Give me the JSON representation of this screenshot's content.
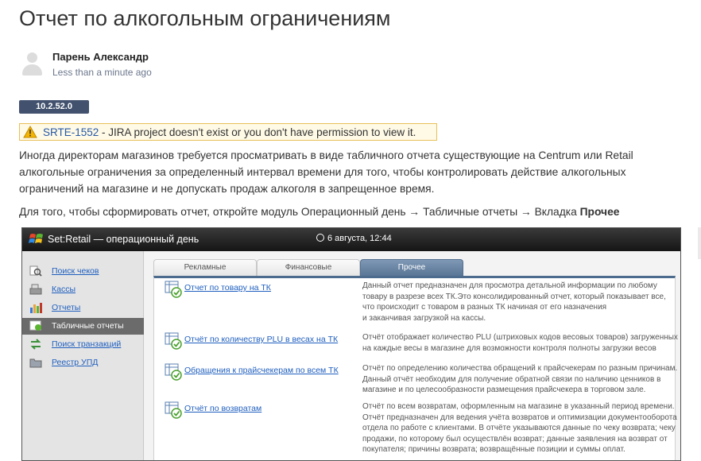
{
  "page": {
    "title": "Отчет по алкогольным ограничениям",
    "author": "Парень Александр",
    "timestamp": "Less than a minute ago",
    "version_badge": "10.2.52.0",
    "jira": {
      "key": "SRTE-1552",
      "message": " - JIRA project doesn't exist or you don't have permission to view it."
    },
    "paragraph1": [
      "Иногда директорам магазинов требуется просматривать в виде табличного отчета существующие на Centrum или Retail",
      "алкогольные ограничения за определенный интервал времени для того, чтобы контролировать действие алкогольных",
      "ограничений на магазине и не допускать продаж алкоголя в запрещенное время."
    ],
    "paragraph2_prefix": "Для того, чтобы сформировать отчет, откройте модуль Операционный день → Табличные отчеты → Вкладка ",
    "paragraph2_bold": "Прочее"
  },
  "app": {
    "title": "Set:Retail — операционный день",
    "clock": "6 августа, 12:44",
    "sidebar": [
      {
        "label": "Поиск чеков",
        "icon": "search-receipt-icon",
        "active": false
      },
      {
        "label": "Кассы",
        "icon": "cash-register-icon",
        "active": false
      },
      {
        "label": "Отчеты",
        "icon": "bar-chart-icon",
        "active": false
      },
      {
        "label": "Табличные отчеты",
        "icon": "table-report-icon",
        "active": true
      },
      {
        "label": "Поиск транзакций",
        "icon": "transactions-icon",
        "active": false
      },
      {
        "label": "Реестр УПД",
        "icon": "folder-icon",
        "active": false
      }
    ],
    "tabs": [
      {
        "label": "Рекламные",
        "active": false
      },
      {
        "label": "Финансовые",
        "active": false
      },
      {
        "label": "Прочее",
        "active": true
      }
    ],
    "reports": [
      {
        "link": "Отчет по товару на ТК",
        "desc": [
          "Данный отчет предназначен для просмотра детальной информации по любому",
          "товару в разрезе всех ТК.Это консолидированный отчет, который показывает все,",
          "что происходит с товаром в разных ТК начиная от его назначения",
          "и заканчивая загрузкой на кассы."
        ]
      },
      {
        "link": "Отчёт по количеству PLU в весах на ТК",
        "desc": [
          "Отчёт отображает количество PLU (штриховых кодов весовых товаров) загруженных",
          "на каждые весы в магазине для возможности контроля полноты загрузки весов"
        ]
      },
      {
        "link": "Обращения к прайсчекерам по всем ТК",
        "desc": [
          "Отчёт по определению количества обращений к прайсчекерам по разным причинам.",
          "Данный отчёт необходим для получение обратной связи по наличию ценников в",
          "магазине и по целесообразности размещения прайсчекера в торговом зале."
        ]
      },
      {
        "link": "Отчёт по возвратам",
        "desc": [
          "Отчёт по всем возвратам, оформленным на магазине в указанный период времени.",
          "Отчёт предназначен для ведения учёта возвратов и оптимизации документооборота",
          "отдела по работе с клиентами. В отчёте указываются данные по чеку возврата; чеку",
          "продажи, по которому был осуществлён возврат; данные заявления на возврат от",
          "покупателя; причины возврата; возвращённые позиции и суммы оплат."
        ]
      }
    ]
  },
  "colors": {
    "badge": "#42526e",
    "jira_link": "#2558a8",
    "warning_bg": "#fffae6",
    "warning_border": "#e8c05a",
    "app_link": "#1f5fbf",
    "active_tab": "#5a7696"
  }
}
